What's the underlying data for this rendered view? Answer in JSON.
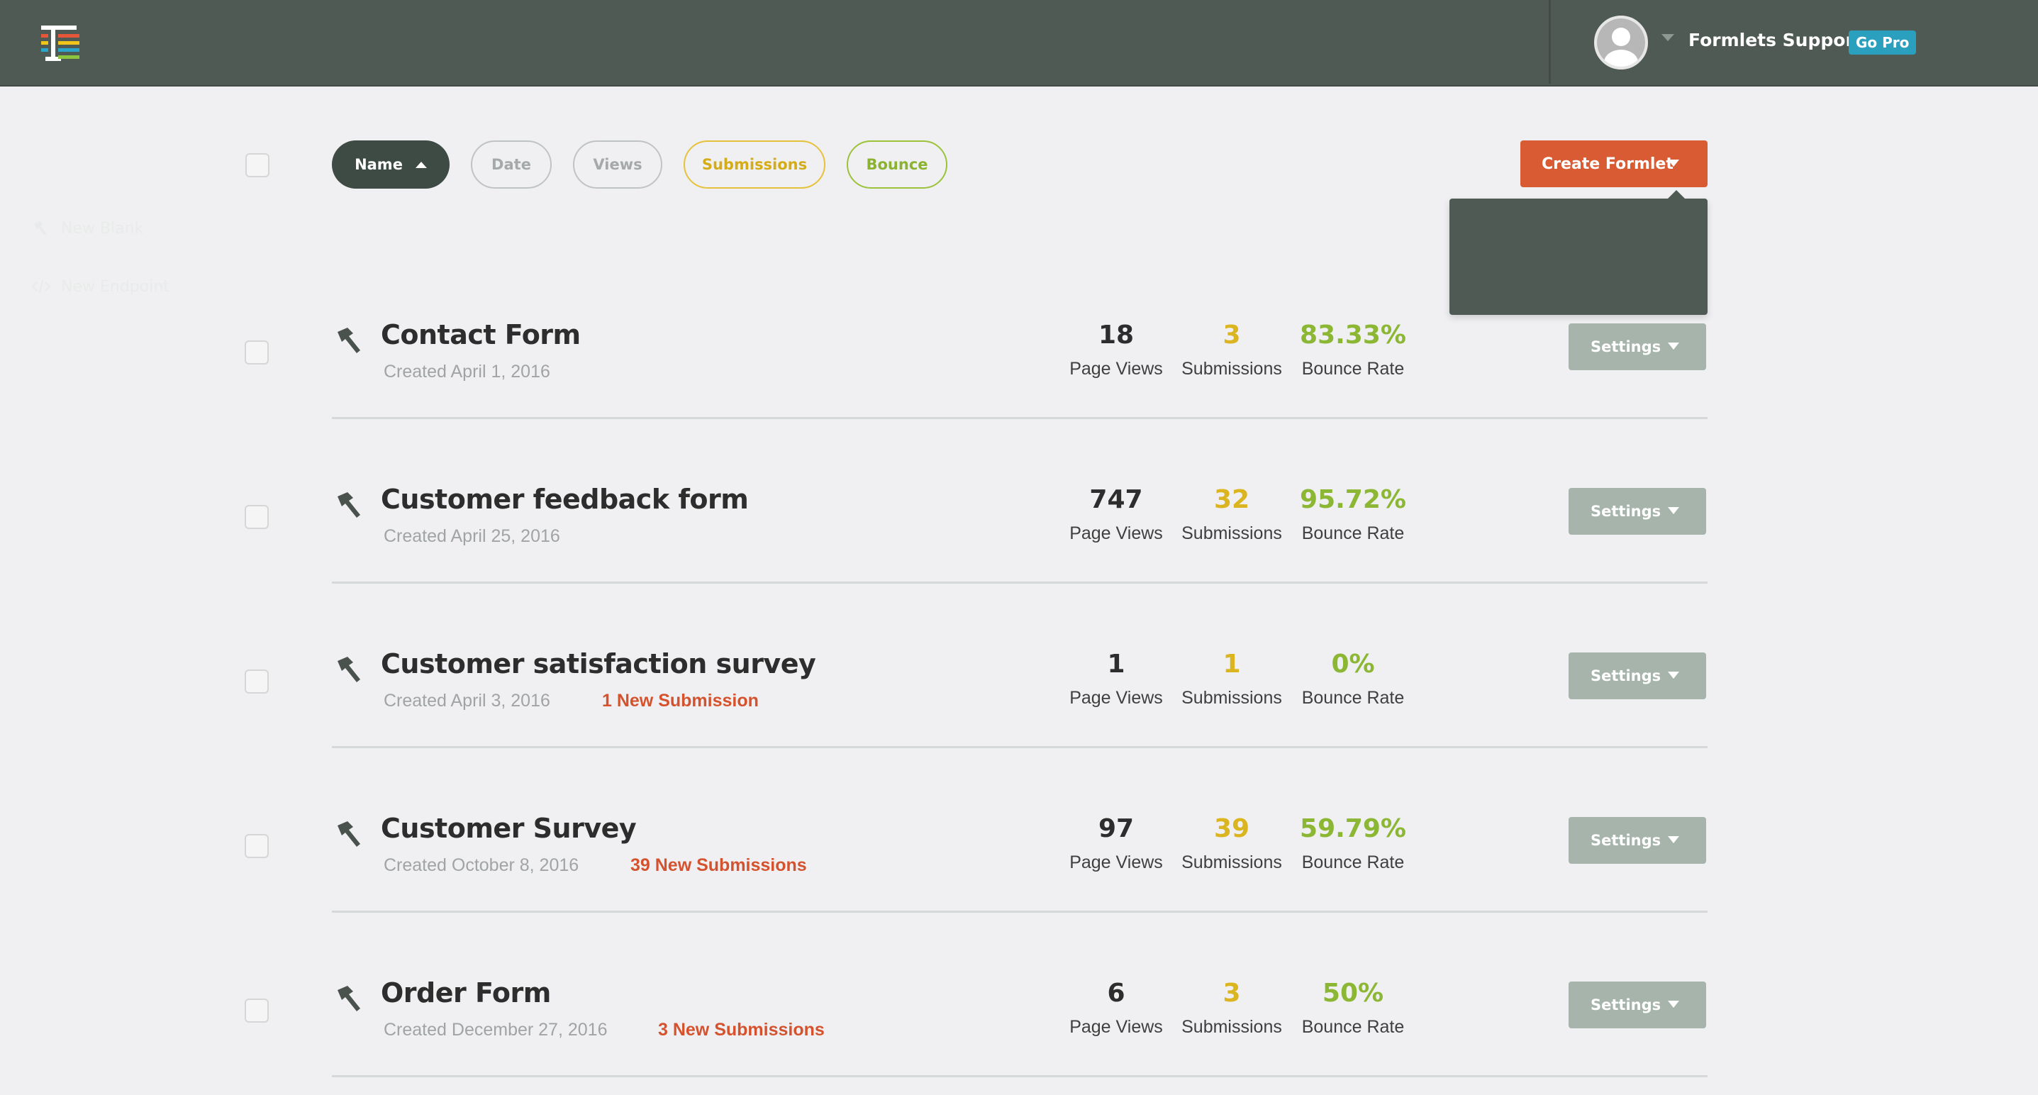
{
  "header": {
    "user_name": "Formlets Support",
    "go_pro_label": "Go Pro"
  },
  "filters": {
    "name": "Name",
    "date": "Date",
    "views": "Views",
    "submissions": "Submissions",
    "bounce": "Bounce"
  },
  "create_button": {
    "label": "Create Formlet",
    "menu": [
      {
        "label": "New Blank",
        "icon": "hammer-icon"
      },
      {
        "label": "New Endpoint",
        "icon": "code-icon"
      }
    ]
  },
  "stat_labels": {
    "views": "Page Views",
    "submissions": "Submissions",
    "bounce": "Bounce Rate"
  },
  "settings_label": "Settings",
  "forms": [
    {
      "title": "Contact Form",
      "created": "Created April 1, 2016",
      "new_submissions": "",
      "views": "18",
      "submissions": "3",
      "bounce": "83.33%"
    },
    {
      "title": "Customer feedback form",
      "created": "Created April 25, 2016",
      "new_submissions": "",
      "views": "747",
      "submissions": "32",
      "bounce": "95.72%"
    },
    {
      "title": "Customer satisfaction survey",
      "created": "Created April 3, 2016",
      "new_submissions": "1 New Submission",
      "views": "1",
      "submissions": "1",
      "bounce": "0%"
    },
    {
      "title": "Customer Survey",
      "created": "Created October 8, 2016",
      "new_submissions": "39 New Submissions",
      "views": "97",
      "submissions": "39",
      "bounce": "59.79%"
    },
    {
      "title": "Order Form",
      "created": "Created December 27, 2016",
      "new_submissions": "3 New Submissions",
      "views": "6",
      "submissions": "3",
      "bounce": "50%"
    }
  ],
  "colors": {
    "topbar": "#505a55",
    "accent_orange": "#d95b33",
    "submissions_yellow": "#dbb51f",
    "bounce_green": "#8cb734",
    "go_pro_blue": "#2b9fbe"
  }
}
